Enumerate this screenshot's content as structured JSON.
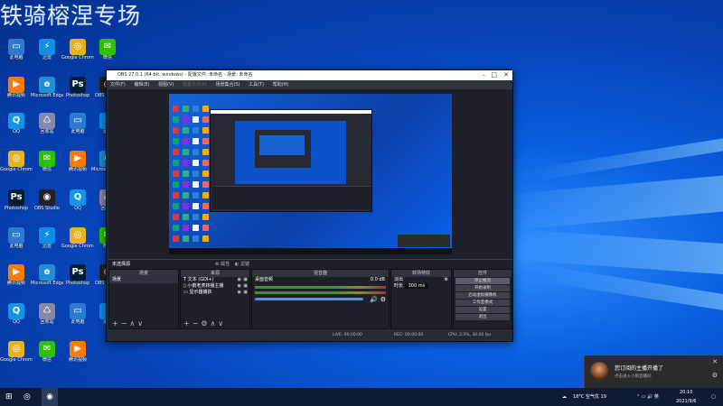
{
  "watermark": "铁骑榕涅专场",
  "desktop_icons": [
    {
      "label": "此电脑",
      "color": "#2c7bd1",
      "glyph": "▭"
    },
    {
      "label": "迅雷",
      "color": "#0f8ee8",
      "glyph": "⚡"
    },
    {
      "label": "Google Chrome",
      "color": "#e7b21f",
      "glyph": "◎"
    },
    {
      "label": "微信",
      "color": "#2dc100",
      "glyph": "✉"
    },
    {
      "label": "腾讯视频",
      "color": "#ff7a00",
      "glyph": "▶"
    },
    {
      "label": "Microsoft Edge",
      "color": "#1e8fd6",
      "glyph": "e"
    },
    {
      "label": "Photoshop",
      "color": "#001e36",
      "glyph": "Ps"
    },
    {
      "label": "OBS Studio",
      "color": "#222",
      "glyph": "◉"
    },
    {
      "label": "QQ",
      "color": "#1295e8",
      "glyph": "Q"
    },
    {
      "label": "回收站",
      "color": "#88a",
      "glyph": "♺"
    }
  ],
  "obs": {
    "title": "OBS 27.0.1 (64-bit, windows) - 配置文件: 未命名 - 场景: 未命名",
    "menu": [
      "文件(F)",
      "编辑(E)",
      "视图(V)",
      "配置文件(P)",
      "场景集合(S)",
      "工具(T)",
      "帮助(H)"
    ],
    "scene_bar_label": "未选择源",
    "properties_btn": "属性",
    "filters_btn": "滤镜",
    "docks": {
      "scenes": {
        "header": "场景",
        "items": [
          "场景"
        ]
      },
      "sources": {
        "header": "来源",
        "items": [
          "文本 (GDI+)",
          "小鹅老虎转播主播",
          "显示器捕获"
        ]
      },
      "mixer": {
        "header": "混音器",
        "channel": "桌面音频",
        "level": "0.0 dB"
      },
      "transitions": {
        "header": "转场特效",
        "selected": "淡出",
        "duration_label": "时长",
        "duration": "300 ms"
      },
      "controls": {
        "header": "控件",
        "buttons": [
          "停止推流",
          "开始录制",
          "启动虚拟摄像机",
          "工作室模式",
          "设置",
          "退出"
        ]
      }
    },
    "status": {
      "live": "LIVE: 00:00:00",
      "rec": "REC: 00:00:00",
      "cpu": "CPU: 2.5%, 30.00 fps"
    }
  },
  "toast": {
    "title": "您订阅的主播开播了",
    "subtitle": "点击进入小鹅直播间"
  },
  "taskbar": {
    "weather": "18°C 空气优 19",
    "time": "20:10",
    "date": "2021/9/6"
  }
}
